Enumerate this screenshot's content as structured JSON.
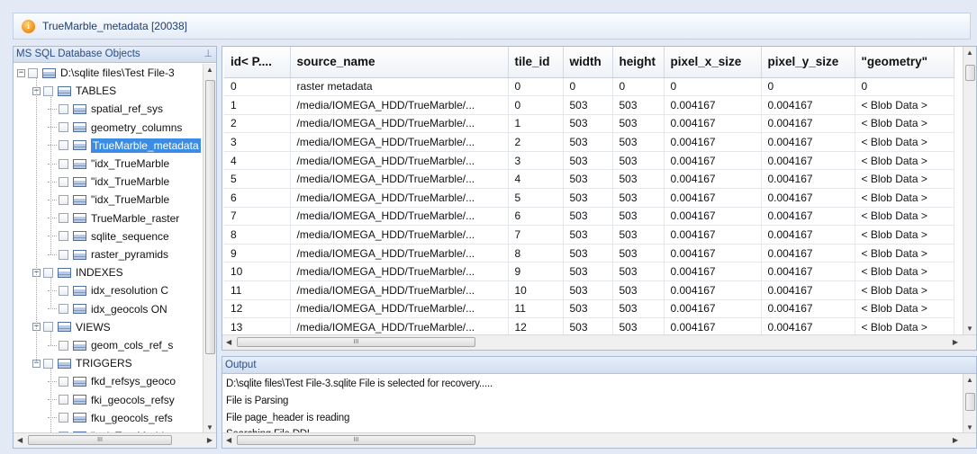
{
  "window": {
    "title": "TrueMarble_metadata [20038]",
    "icon": "info-icon"
  },
  "left_panel": {
    "title": "MS SQL Database Objects",
    "root": "D:\\sqlite files\\Test File-3",
    "groups": [
      {
        "label": "TABLES",
        "items": [
          "spatial_ref_sys",
          "geometry_columns",
          "TrueMarble_metadata",
          "\"idx_TrueMarble",
          "\"idx_TrueMarble",
          "\"idx_TrueMarble",
          "TrueMarble_raster",
          "sqlite_sequence",
          "raster_pyramids"
        ],
        "selected_index": 2
      },
      {
        "label": "INDEXES",
        "items": [
          "idx_resolution C",
          "idx_geocols ON"
        ]
      },
      {
        "label": "VIEWS",
        "items": [
          "geom_cols_ref_s"
        ]
      },
      {
        "label": "TRIGGERS",
        "items": [
          "fkd_refsys_geoco",
          "fki_geocols_refsy",
          "fku_geocols_refs",
          "\"ggi_TrueMarble"
        ]
      }
    ]
  },
  "grid": {
    "columns": [
      "id< P....",
      "source_name",
      "tile_id",
      "width",
      "height",
      "pixel_x_size",
      "pixel_y_size",
      "\"geometry\""
    ],
    "rows": [
      [
        "0",
        "raster metadata",
        "0",
        "0",
        "0",
        "0",
        "0",
        "0"
      ],
      [
        "1",
        "/media/IOMEGA_HDD/TrueMarble/...",
        "0",
        "503",
        "503",
        "0.004167",
        "0.004167",
        "< Blob Data >"
      ],
      [
        "2",
        "/media/IOMEGA_HDD/TrueMarble/...",
        "1",
        "503",
        "503",
        "0.004167",
        "0.004167",
        "< Blob Data >"
      ],
      [
        "3",
        "/media/IOMEGA_HDD/TrueMarble/...",
        "2",
        "503",
        "503",
        "0.004167",
        "0.004167",
        "< Blob Data >"
      ],
      [
        "4",
        "/media/IOMEGA_HDD/TrueMarble/...",
        "3",
        "503",
        "503",
        "0.004167",
        "0.004167",
        "< Blob Data >"
      ],
      [
        "5",
        "/media/IOMEGA_HDD/TrueMarble/...",
        "4",
        "503",
        "503",
        "0.004167",
        "0.004167",
        "< Blob Data >"
      ],
      [
        "6",
        "/media/IOMEGA_HDD/TrueMarble/...",
        "5",
        "503",
        "503",
        "0.004167",
        "0.004167",
        "< Blob Data >"
      ],
      [
        "7",
        "/media/IOMEGA_HDD/TrueMarble/...",
        "6",
        "503",
        "503",
        "0.004167",
        "0.004167",
        "< Blob Data >"
      ],
      [
        "8",
        "/media/IOMEGA_HDD/TrueMarble/...",
        "7",
        "503",
        "503",
        "0.004167",
        "0.004167",
        "< Blob Data >"
      ],
      [
        "9",
        "/media/IOMEGA_HDD/TrueMarble/...",
        "8",
        "503",
        "503",
        "0.004167",
        "0.004167",
        "< Blob Data >"
      ],
      [
        "10",
        "/media/IOMEGA_HDD/TrueMarble/...",
        "9",
        "503",
        "503",
        "0.004167",
        "0.004167",
        "< Blob Data >"
      ],
      [
        "11",
        "/media/IOMEGA_HDD/TrueMarble/...",
        "10",
        "503",
        "503",
        "0.004167",
        "0.004167",
        "< Blob Data >"
      ],
      [
        "12",
        "/media/IOMEGA_HDD/TrueMarble/...",
        "11",
        "503",
        "503",
        "0.004167",
        "0.004167",
        "< Blob Data >"
      ],
      [
        "13",
        "/media/IOMEGA_HDD/TrueMarble/...",
        "12",
        "503",
        "503",
        "0.004167",
        "0.004167",
        "< Blob Data >"
      ]
    ]
  },
  "output": {
    "title": "Output",
    "lines": [
      "D:\\sqlite files\\Test File-3.sqlite File is selected for recovery.....",
      "File is Parsing",
      "File page_header is reading",
      "Searching File DDL"
    ]
  },
  "scrollbar": {
    "grip": "III"
  }
}
